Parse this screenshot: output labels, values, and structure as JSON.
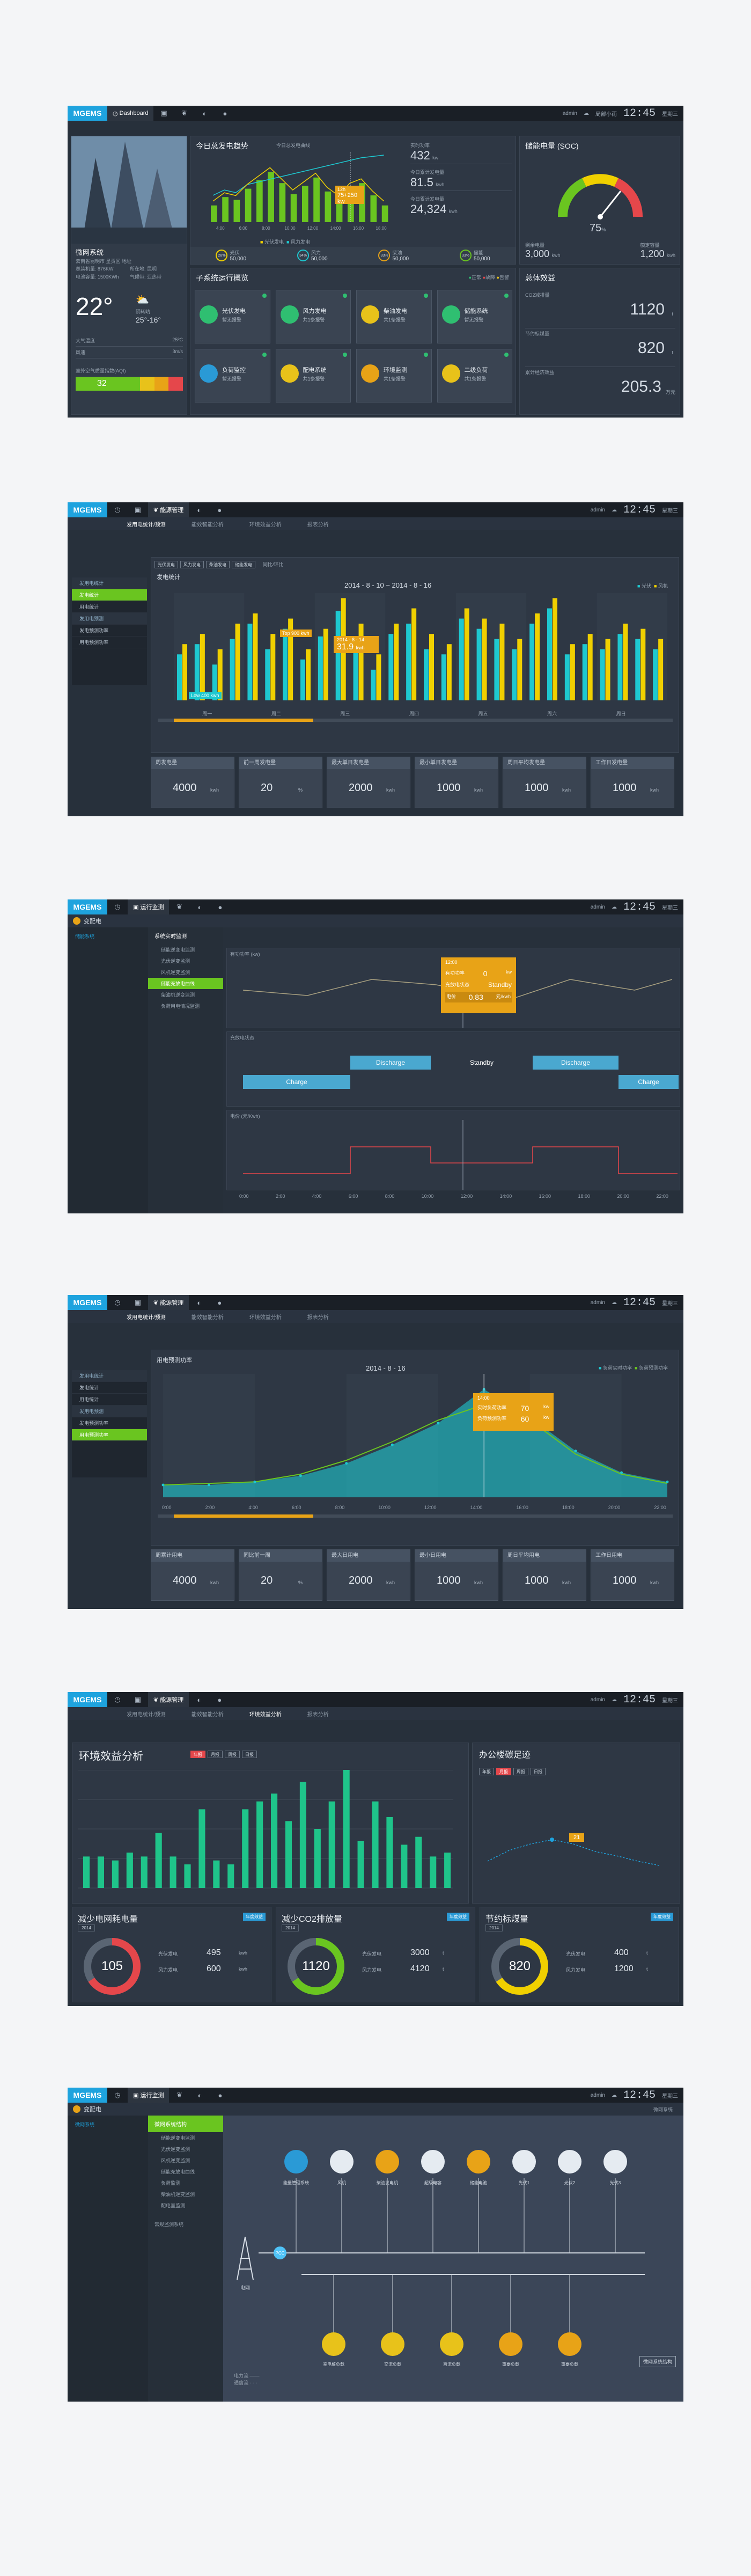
{
  "common": {
    "logo": "MGEMS",
    "user": "admin",
    "clock": "12:45",
    "weather": "局部小雨",
    "weekday": "星期三",
    "date": "2014.8.13",
    "temp": "12℃-25℃",
    "colors": {
      "accent": "#1ea3de",
      "green": "#6ac520",
      "yellow": "#f0d000",
      "cyan": "#1ec8d0",
      "orange": "#e8a317",
      "red": "#e5474b"
    }
  },
  "s1": {
    "nav_label": "Dashboard",
    "site_name": "微网系统",
    "site_addr": "云南省昆明市 呈贡区 地址",
    "site_meta": [
      "总装机量: 876KW",
      "所在地: 昆明",
      "电池容量: 1500KWh",
      "气候带: 亚热带"
    ],
    "weather_temp": "22°",
    "weather_desc": "阴转晴",
    "weather_range": "25°-16°",
    "weather_rows": [
      [
        "大气温度",
        "25ºC"
      ],
      [
        "风速",
        "3m/s"
      ]
    ],
    "aqi_label": "室外空气质量指数(AQI)",
    "aqi_value": "32",
    "trend_title": "今日总发电趋势",
    "trend_sub": "今日总发电曲线",
    "trend_tooltip_time": "12h",
    "trend_tooltip_value": "75+250",
    "trend_tooltip_unit": "kw",
    "trend_legend": [
      "光伏发电",
      "风力发电"
    ],
    "trend_kpis": [
      [
        "实时功率",
        "432",
        "kw"
      ],
      [
        "今日累计发电量",
        "81.5",
        "kwh"
      ],
      [
        "今日累计发电量",
        "24,324",
        "kwh"
      ]
    ],
    "gens": [
      [
        "光伏",
        "50,000"
      ],
      [
        "风力",
        "50,000"
      ],
      [
        "柴油",
        "50,000"
      ],
      [
        "储能",
        "50,000"
      ]
    ],
    "gen_pct": [
      "28%",
      "34%",
      "33%",
      "33%"
    ],
    "soc_title": "储能电量 (SOC)",
    "soc_value": "75",
    "soc_unit": "%",
    "soc_bottom": [
      [
        "剩余电量",
        "3,000",
        "kwh"
      ],
      [
        "额定容量",
        "1,200",
        "kwh"
      ]
    ],
    "sub_title": "子系统运行概览",
    "sub_legend": [
      "正常",
      "故障",
      "告警"
    ],
    "subsystems": [
      [
        "光伏发电",
        "暂无报警",
        "#2fbf71"
      ],
      [
        "风力发电",
        "共1条报警",
        "#2fbf71"
      ],
      [
        "柴油发电",
        "共1条报警",
        "#e8c21a"
      ],
      [
        "储能系统",
        "暂无报警",
        "#2fbf71"
      ],
      [
        "负荷监控",
        "暂无报警",
        "#2a9ad6"
      ],
      [
        "配电系统",
        "共1条报警",
        "#e8c21a"
      ],
      [
        "环境监测",
        "共1条报警",
        "#e8a317"
      ],
      [
        "二级负荷",
        "共1条报警",
        "#e8c21a"
      ]
    ],
    "eco_title": "总体效益",
    "eco_rows": [
      [
        "CO2减排量",
        "1120",
        "t"
      ],
      [
        "节约标煤量",
        "820",
        "t"
      ],
      [
        "累计经济效益",
        "205.3",
        "万元"
      ]
    ]
  },
  "s2": {
    "nav_label": "能源管理",
    "tabs": [
      "发用电统计/预测",
      "能效智能分析",
      "环境效益分析",
      "报表分析"
    ],
    "side": [
      "发用电统计",
      "发电统计",
      "用电统计",
      "发用电预测",
      "发电预测功率",
      "用电预测功率"
    ],
    "chart_title": "发电统计",
    "chart_range": "2014 - 8 - 10 ~ 2014 - 8 - 16",
    "filters": [
      "光伏发电",
      "风力发电",
      "柴油发电",
      "储能发电"
    ],
    "period": "同比/环比",
    "legend": [
      "光伏",
      "风机"
    ],
    "top_label": "Top 900",
    "top_unit": "kwh",
    "low_label": "Low 400",
    "low_unit": "kwh",
    "tip_date": "2014 - 8 - 14",
    "tip_value": "31.9",
    "tip_unit": "kwh",
    "xdays": [
      "周一",
      "周二",
      "周三",
      "周四",
      "周五",
      "周六",
      "周日"
    ],
    "kpis": [
      [
        "周发电量",
        "4000",
        "kwh"
      ],
      [
        "前一周发电量",
        "20",
        "%"
      ],
      [
        "最大单日发电量",
        "2000",
        "kwh"
      ],
      [
        "最小单日发电量",
        "1000",
        "kwh"
      ],
      [
        "周日平均发电量",
        "1000",
        "kwh"
      ],
      [
        "工作日发电量",
        "1000",
        "kwh"
      ]
    ]
  },
  "s3": {
    "nav_label": "运行监测",
    "sys_label": "变配电",
    "sub_sys": "储能系统",
    "side_title": "系统实时监测",
    "side_items": [
      "储能逆变电监测",
      "光伏逆变监测",
      "风机逆变监测",
      "储能充放电曲线",
      "柴油机逆变监测",
      "负荷用电情况监测"
    ],
    "panel1": "有功功率 (kw)",
    "panel2": "充放电状态",
    "panel3": "电价 (元/Kwh)",
    "tip_time": "12:00",
    "tip_rows": [
      [
        "有功功率",
        "0",
        "kw"
      ],
      [
        "充放电状态",
        "Standby",
        ""
      ],
      [
        "电价",
        "0.83",
        "元/kwh"
      ]
    ],
    "states": [
      "Charge",
      "Discharge",
      "Standby",
      "Discharge",
      "Charge"
    ],
    "xticks": [
      "0:00",
      "2:00",
      "4:00",
      "6:00",
      "8:00",
      "10:00",
      "12:00",
      "14:00",
      "16:00",
      "18:00",
      "20:00",
      "22:00"
    ]
  },
  "s4": {
    "nav_label": "能源管理",
    "side": [
      "发用电统计",
      "发电统计",
      "用电统计",
      "发用电预测",
      "发电预测功率",
      "用电预测功率"
    ],
    "chart_title": "用电预测功率",
    "date": "2014 - 8 - 16",
    "legend": [
      "负荷实时功率",
      "负荷预测功率"
    ],
    "tip_time": "14:00",
    "tip_rows": [
      [
        "实时负荷功率",
        "70",
        "kw"
      ],
      [
        "负荷预测功率",
        "60",
        "kw"
      ]
    ],
    "xticks": [
      "0:00",
      "2:00",
      "4:00",
      "6:00",
      "8:00",
      "10:00",
      "12:00",
      "14:00",
      "16:00",
      "18:00",
      "20:00",
      "22:00"
    ],
    "kpis": [
      [
        "周累计用电",
        "4000",
        "kwh"
      ],
      [
        "同比前一周",
        "20",
        "%"
      ],
      [
        "最大日用电",
        "2000",
        "kwh"
      ],
      [
        "最小日用电",
        "1000",
        "kwh"
      ],
      [
        "周日平均用电",
        "1000",
        "kwh"
      ],
      [
        "工作日用电",
        "1000",
        "kwh"
      ]
    ]
  },
  "s5": {
    "env_title": "环境效益分析",
    "office_title": "办公楼碳足迹",
    "btns": [
      "年报",
      "月报",
      "周报",
      "日报"
    ],
    "office_btns": [
      "年报",
      "月报",
      "周报",
      "日报"
    ],
    "tip_value": "21",
    "c1": {
      "title": "减少电网耗电量",
      "select": "2014",
      "value": "105",
      "rows": [
        [
          "光伏发电",
          "495",
          "kwh"
        ],
        [
          "风力发电",
          "600",
          "kwh"
        ]
      ]
    },
    "c2": {
      "title": "减少CO2排放量",
      "select": "2014",
      "value": "1120",
      "rows": [
        [
          "光伏发电",
          "3000",
          "t"
        ],
        [
          "风力发电",
          "4120",
          "t"
        ]
      ]
    },
    "c3": {
      "title": "节约标煤量",
      "select": "2014",
      "value": "820",
      "rows": [
        [
          "光伏发电",
          "400",
          "t"
        ],
        [
          "风力发电",
          "1200",
          "t"
        ]
      ]
    },
    "c_btn": "年度效益"
  },
  "s6": {
    "nav_label": "运行监测",
    "sys_label": "变配电",
    "sub_sys": "微网系统",
    "side_title": "微网系统结构",
    "side_items": [
      "储能逆变电监测",
      "光伏逆变监测",
      "风机逆变监测",
      "储能充放电曲线",
      "负荷监测",
      "柴油机逆变监测",
      "配电室监测"
    ],
    "side_items2": [
      "常规监测系统"
    ],
    "grid_label": "电网",
    "pcc": "PCC",
    "top_nodes": [
      "能量管理系统",
      "风机",
      "柴油发电机",
      "超级电容",
      "储能电池",
      "光伏1",
      "光伏2",
      "光伏3"
    ],
    "bottom_nodes": [
      "充电桩负载",
      "交流负载",
      "直流负载",
      "重要负载",
      "重要负载"
    ],
    "btn": "微网系统结构",
    "legend": [
      "电力流",
      "通信流"
    ]
  },
  "chart_data": [
    {
      "type": "bar",
      "title": "今日总发电曲线",
      "categories": [
        "4:00",
        "6:00",
        "8:00",
        "10:00",
        "12:00",
        "14:00",
        "16:00",
        "18:00"
      ],
      "series": [
        {
          "name": "光伏发电",
          "values": [
            30,
            45,
            40,
            60,
            75,
            90,
            70,
            50,
            65,
            80,
            55,
            40,
            62,
            70,
            48,
            30
          ]
        },
        {
          "name": "风力发电",
          "values": [
            100,
            120,
            110,
            140,
            150,
            160,
            170,
            180,
            190,
            200,
            210,
            220,
            230,
            240,
            245,
            250
          ]
        }
      ]
    },
    {
      "type": "bar",
      "title": "发电统计",
      "categories": [
        "周一",
        "周二",
        "周三",
        "周四",
        "周五",
        "周六",
        "周日"
      ],
      "series": [
        {
          "name": "光伏",
          "values": [
            18,
            22,
            14,
            24,
            30,
            20,
            28,
            16,
            25,
            35,
            22,
            12,
            26,
            30,
            20,
            18,
            32,
            28,
            24,
            20,
            30,
            36,
            18,
            22,
            20,
            26,
            24,
            20
          ]
        },
        {
          "name": "风机",
          "values": [
            22,
            26,
            20,
            30,
            34,
            26,
            32,
            20,
            28,
            40,
            30,
            18,
            30,
            36,
            26,
            22,
            36,
            32,
            30,
            24,
            34,
            40,
            22,
            26,
            24,
            30,
            28,
            24
          ]
        }
      ]
    },
    {
      "type": "line",
      "title": "用电预测功率",
      "x": [
        "0:00",
        "2:00",
        "4:00",
        "6:00",
        "8:00",
        "10:00",
        "12:00",
        "14:00",
        "16:00",
        "18:00",
        "20:00",
        "22:00"
      ],
      "series": [
        {
          "name": "负荷实时功率",
          "values": [
            8,
            8,
            10,
            14,
            22,
            34,
            48,
            70,
            52,
            30,
            16,
            10
          ]
        },
        {
          "name": "负荷预测功率",
          "values": [
            8,
            9,
            10,
            15,
            24,
            36,
            50,
            60,
            50,
            28,
            15,
            9
          ]
        }
      ]
    },
    {
      "type": "bar",
      "title": "环境效益分析",
      "categories": [
        "1",
        "2",
        "3",
        "4",
        "5",
        "6",
        "7",
        "8",
        "9",
        "10",
        "11",
        "12",
        "13",
        "14",
        "15",
        "16",
        "17",
        "18",
        "19",
        "20",
        "21",
        "22",
        "23",
        "24",
        "25",
        "26"
      ],
      "values": [
        40,
        40,
        35,
        45,
        40,
        70,
        40,
        30,
        100,
        35,
        30,
        100,
        110,
        120,
        85,
        135,
        75,
        110,
        150,
        60,
        110,
        90,
        55,
        65,
        40,
        45
      ]
    }
  ]
}
